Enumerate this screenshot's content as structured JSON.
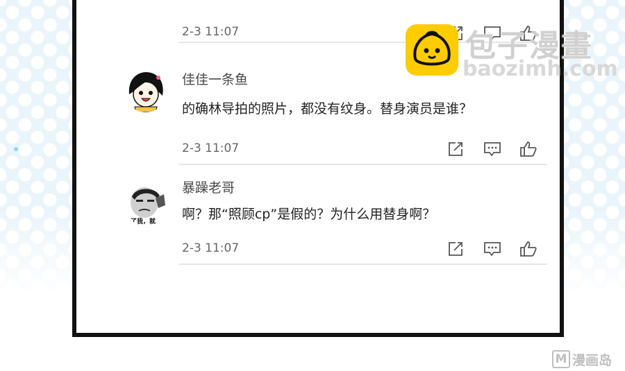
{
  "comments": [
    {
      "username": "",
      "content": "",
      "time": "2-3 11:07"
    },
    {
      "username": "佳佳一条鱼",
      "content": "的确林导拍的照片，都没有纹身。替身演员是谁？",
      "time": "2-3 11:07"
    },
    {
      "username": "暴躁老哥",
      "content": "啊？那“照顾cp”是假的？为什么用替身啊？",
      "time": "2-3 11:07",
      "avatar_caption": "了我，就"
    }
  ],
  "actions": {
    "share_icon": "share-icon",
    "comment_icon": "comment-icon",
    "like_icon": "thumbs-up-icon"
  },
  "watermark": {
    "brand_cn": "包子漫畫",
    "brand_url": "baozimh.com",
    "corner_letter": "M",
    "corner_text": "漫画岛"
  },
  "colors": {
    "frame": "#111111",
    "text_primary": "#222222",
    "text_secondary": "#4a4a4a",
    "logo_yellow": "#ffcc00",
    "background_dots": "#eaf4fb"
  }
}
